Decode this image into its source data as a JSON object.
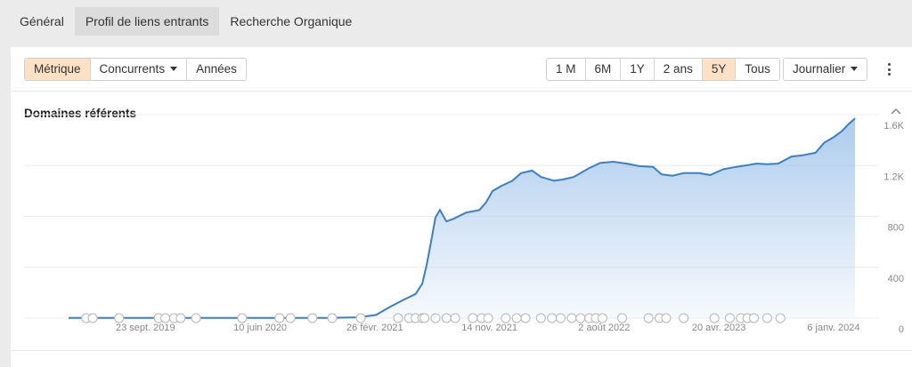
{
  "tabs": [
    "Général",
    "Profil de liens entrants",
    "Recherche Organique"
  ],
  "active_tab": 1,
  "toolbar": {
    "view_buttons": [
      "Métrique",
      "Concurrents",
      "Années"
    ],
    "range_buttons": [
      "1 M",
      "6M",
      "1Y",
      "2 ans",
      "5Y",
      "Tous"
    ],
    "interval_label": "Journalier"
  },
  "colors": {
    "line": "#3b7fc4",
    "area": "#a9c9ec",
    "active_bg": "#fde1c4"
  },
  "chart_data": {
    "type": "area",
    "title": "Domaines référents",
    "x_tick_labels": [
      "23 sept. 2019",
      "10 juin 2020",
      "26 févr. 2021",
      "14 nov. 2021",
      "2 août 2022",
      "20 avr. 2023",
      "6 janv. 2024"
    ],
    "x_ticks_days": [
      175,
      436,
      697,
      958,
      1219,
      1480,
      1741
    ],
    "y_tick_labels": [
      "0",
      "400",
      "800",
      "1.2K",
      "1.6K"
    ],
    "y_ticks": [
      0,
      400,
      800,
      1200,
      1600
    ],
    "ylim": [
      0,
      1600
    ],
    "xlim_days": [
      0,
      1800
    ],
    "series": [
      {
        "x": [
          0,
          90,
          180,
          270,
          360,
          450,
          540,
          600,
          660,
          700,
          730,
          760,
          790,
          805,
          815,
          825,
          835,
          845,
          860,
          875,
          905,
          935,
          950,
          965,
          985,
          1010,
          1030,
          1055,
          1075,
          1105,
          1125,
          1150,
          1185,
          1210,
          1240,
          1270,
          1300,
          1330,
          1350,
          1375,
          1400,
          1435,
          1460,
          1490,
          1520,
          1540,
          1565,
          1590,
          1615,
          1645,
          1670,
          1700,
          1720,
          1740,
          1760,
          1775,
          1790
        ],
        "values": [
          2,
          2,
          2,
          2,
          2,
          2,
          2,
          2,
          6,
          25,
          85,
          140,
          190,
          270,
          420,
          600,
          790,
          850,
          760,
          780,
          830,
          850,
          910,
          1000,
          1040,
          1080,
          1140,
          1160,
          1110,
          1080,
          1090,
          1110,
          1180,
          1220,
          1230,
          1215,
          1195,
          1190,
          1130,
          1120,
          1140,
          1140,
          1125,
          1170,
          1190,
          1200,
          1215,
          1210,
          1215,
          1270,
          1280,
          1300,
          1380,
          1420,
          1470,
          1525,
          1570
        ]
      }
    ]
  }
}
